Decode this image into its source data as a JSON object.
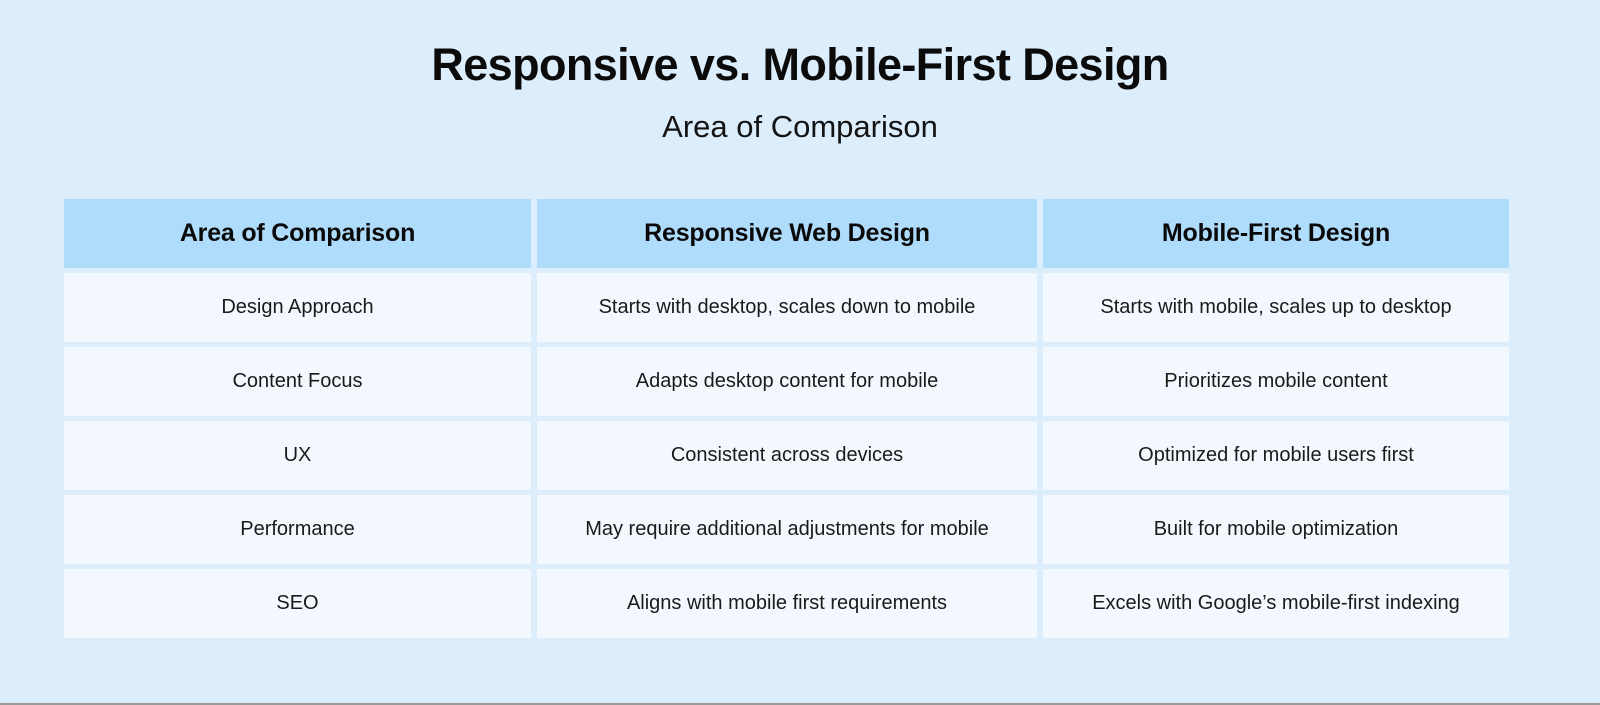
{
  "title": "Responsive vs. Mobile-First Design",
  "subtitle": "Area of Comparison",
  "colors": {
    "page_background": "#dcedfc",
    "header_cell": "#b0dcfc",
    "body_cell": "#f2f8fe",
    "text": "#0a0a0a"
  },
  "table": {
    "columns": [
      "Area of Comparison",
      "Responsive Web Design",
      "Mobile-First Design"
    ],
    "rows": [
      {
        "area": "Design Approach",
        "responsive": "Starts with desktop, scales down to mobile",
        "mobile_first": "Starts with mobile, scales up to desktop"
      },
      {
        "area": "Content Focus",
        "responsive": "Adapts desktop content for mobile",
        "mobile_first": "Prioritizes mobile content"
      },
      {
        "area": "UX",
        "responsive": "Consistent across devices",
        "mobile_first": "Optimized for mobile users first"
      },
      {
        "area": "Performance",
        "responsive": "May require additional adjustments for mobile",
        "mobile_first": "Built for mobile optimization"
      },
      {
        "area": "SEO",
        "responsive": "Aligns with mobile first requirements",
        "mobile_first": "Excels with Google’s mobile-first indexing"
      }
    ]
  }
}
